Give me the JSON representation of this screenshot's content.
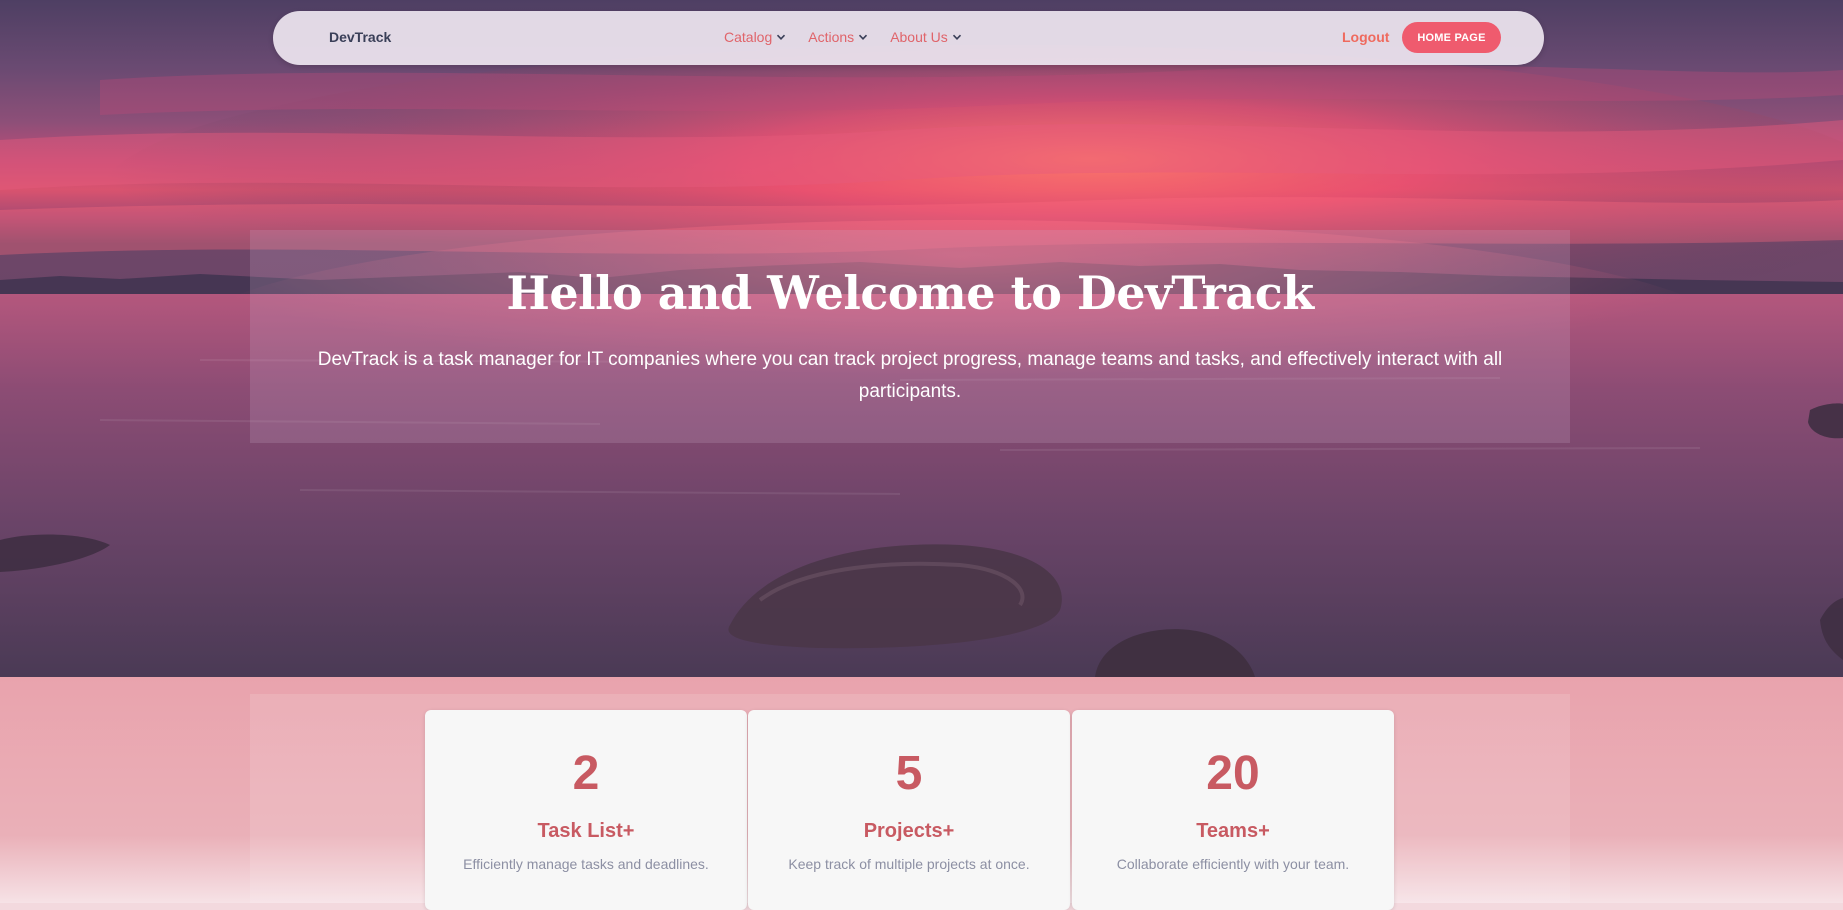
{
  "navbar": {
    "brand": "DevTrack",
    "menu": [
      {
        "label": "Catalog"
      },
      {
        "label": "Actions"
      },
      {
        "label": "About Us"
      }
    ],
    "logout_label": "Logout",
    "home_button_label": "HOME PAGE"
  },
  "hero": {
    "title": "Hello and Welcome to DevTrack",
    "description": "DevTrack is a task manager for IT companies where you can track project progress, manage teams and tasks, and effectively interact with all participants."
  },
  "stats": [
    {
      "number": "2",
      "title": "Task List+",
      "description": "Efficiently manage tasks and deadlines."
    },
    {
      "number": "5",
      "title": "Projects+",
      "description": "Keep track of multiple projects at once."
    },
    {
      "number": "20",
      "title": "Teams+",
      "description": "Collaborate efficiently with your team."
    }
  ],
  "colors": {
    "accent": "#ef5b6e",
    "nav_link": "#e0646a",
    "stat_text": "#c85a62"
  }
}
